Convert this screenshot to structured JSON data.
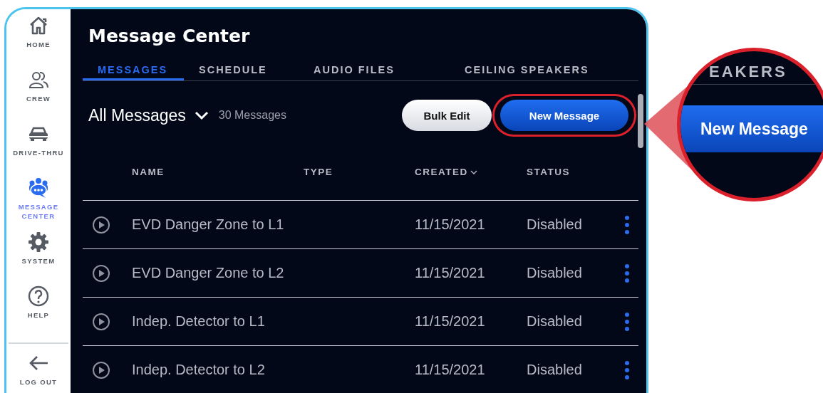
{
  "sidebar": {
    "items": [
      {
        "kind": "home",
        "label": "HOME",
        "selected": false
      },
      {
        "kind": "crew",
        "label": "CREW",
        "selected": false
      },
      {
        "kind": "car",
        "label": "DRIVE-THRU",
        "selected": false
      },
      {
        "kind": "message",
        "label": "MESSAGE CENTER",
        "selected": true
      },
      {
        "kind": "gear",
        "label": "SYSTEM",
        "selected": false
      },
      {
        "kind": "help",
        "label": "HELP",
        "selected": false
      },
      {
        "kind": "logout",
        "label": "LOG OUT",
        "selected": false
      }
    ]
  },
  "title": "Message Center",
  "tabs": [
    {
      "label": "MESSAGES",
      "selected": true
    },
    {
      "label": "SCHEDULE",
      "selected": false
    },
    {
      "label": "AUDIO FILES",
      "selected": false
    },
    {
      "label": "CEILING SPEAKERS",
      "selected": false
    }
  ],
  "toolbar": {
    "filter": "All Messages",
    "count": "30 Messages",
    "buttons": [
      {
        "kind": "secondary",
        "label": "Bulk Edit",
        "highlighted": false
      },
      {
        "kind": "primary",
        "label": "New Message",
        "highlighted": true
      }
    ]
  },
  "table": {
    "columns": [
      {
        "label": "NAME",
        "sorted": false
      },
      {
        "label": "TYPE",
        "sorted": false
      },
      {
        "label": "CREATED",
        "sorted": true
      },
      {
        "label": "STATUS",
        "sorted": false
      }
    ],
    "rows": [
      {
        "name": "EVD Danger Zone to L1",
        "created": "11/15/2021",
        "status": "Disabled"
      },
      {
        "name": "EVD Danger Zone to L2",
        "created": "11/15/2021",
        "status": "Disabled"
      },
      {
        "name": "Indep. Detector to L1",
        "created": "11/15/2021",
        "status": "Disabled"
      },
      {
        "name": "Indep. Detector to L2",
        "created": "11/15/2021",
        "status": "Disabled"
      }
    ]
  },
  "magnifier": {
    "tab_fragment": "EAKERS",
    "button": "New Message"
  }
}
